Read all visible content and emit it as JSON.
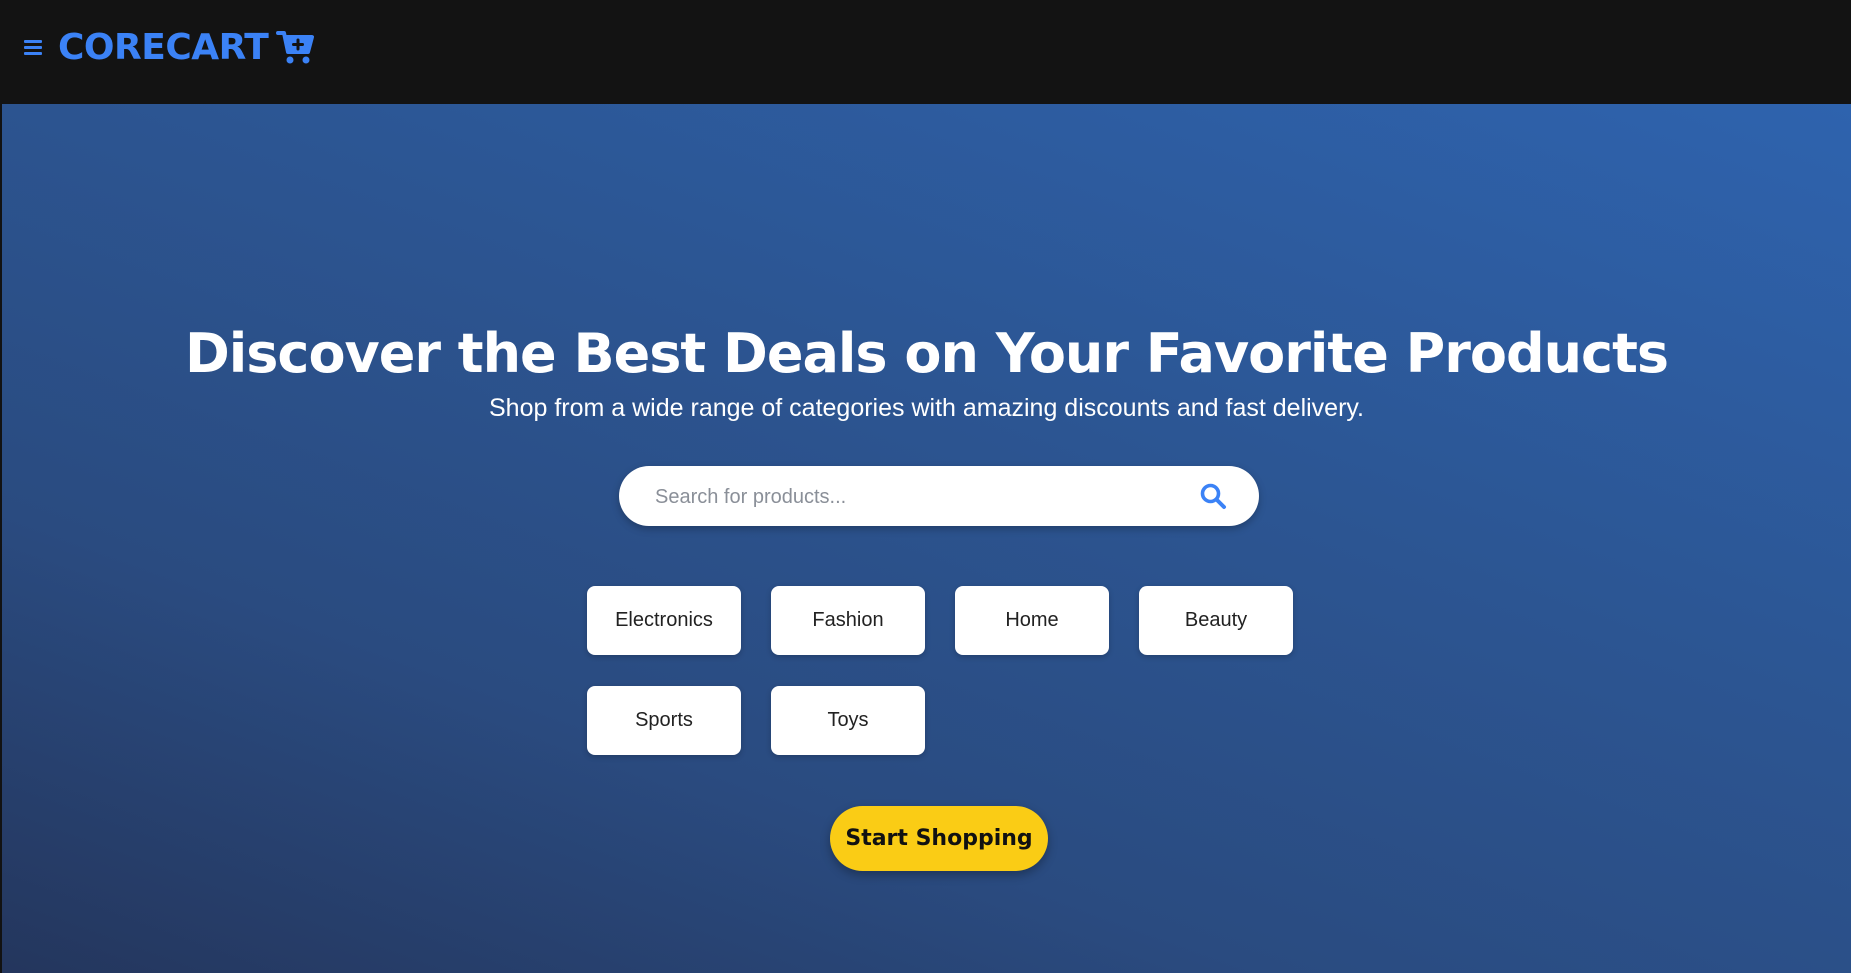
{
  "header": {
    "brand_name": "CORECART",
    "menu_icon": "hamburger-menu-icon",
    "cart_icon": "shopping-cart-plus-icon",
    "accent_color": "#3b82f6"
  },
  "hero": {
    "headline": "Discover the Best Deals on Your Favorite Products",
    "subtitle": "Shop from a wide range of categories with amazing discounts and fast delivery.",
    "search": {
      "placeholder": "Search for products...",
      "value": "",
      "icon": "search-icon"
    },
    "categories": [
      {
        "label": "Electronics"
      },
      {
        "label": "Fashion"
      },
      {
        "label": "Home"
      },
      {
        "label": "Beauty"
      },
      {
        "label": "Sports"
      },
      {
        "label": "Toys"
      }
    ],
    "cta_label": "Start Shopping",
    "cta_color": "#facc15"
  }
}
